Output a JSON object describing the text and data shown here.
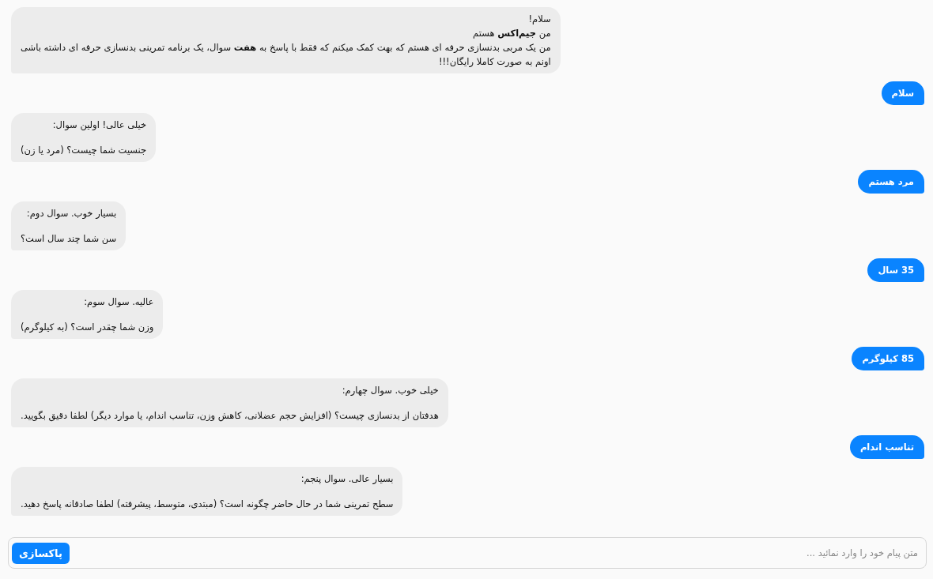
{
  "messages": [
    {
      "kind": "incoming",
      "paragraphs": [
        [
          "سلام!",
          "من **جیم‌اکس** هستم",
          "من یک مربی بدنسازی حرفه ای هستم که بهت کمک میکنم که فقط با پاسخ به **هفت** سوال، یک برنامه تمرینی بدنسازی حرفه ای داشته باشی",
          "اونم به صورت کاملا رایگان!!!"
        ]
      ]
    },
    {
      "kind": "outgoing",
      "paragraphs": [
        [
          "سلام"
        ]
      ]
    },
    {
      "kind": "incoming",
      "paragraphs": [
        [
          "خیلی عالی! اولین سوال:"
        ],
        [
          "جنسیت شما چیست؟ (مرد یا زن)"
        ]
      ]
    },
    {
      "kind": "outgoing",
      "paragraphs": [
        [
          "مرد هستم"
        ]
      ]
    },
    {
      "kind": "incoming",
      "paragraphs": [
        [
          "بسیار خوب. سوال دوم:"
        ],
        [
          "سن شما چند سال است؟"
        ]
      ]
    },
    {
      "kind": "outgoing",
      "paragraphs": [
        [
          "35 سال"
        ]
      ]
    },
    {
      "kind": "incoming",
      "paragraphs": [
        [
          "عالیه. سوال سوم:"
        ],
        [
          "وزن شما چقدر است؟ (به کیلوگرم)"
        ]
      ]
    },
    {
      "kind": "outgoing",
      "paragraphs": [
        [
          "85 کیلوگرم"
        ]
      ]
    },
    {
      "kind": "incoming",
      "paragraphs": [
        [
          "خیلی خوب. سوال چهارم:"
        ],
        [
          "هدفتان از بدنسازی چیست؟ (افزایش حجم عضلانی، کاهش وزن، تناسب اندام، یا موارد دیگر) لطفا دقیق بگویید."
        ]
      ]
    },
    {
      "kind": "outgoing",
      "paragraphs": [
        [
          "تناسب اندام"
        ]
      ]
    },
    {
      "kind": "incoming",
      "paragraphs": [
        [
          "بسیار عالی. سوال پنجم:"
        ],
        [
          "سطح تمرینی شما در حال حاضر چگونه است؟ (مبتدی، متوسط، پیشرفته) لطفا صادقانه پاسخ دهید."
        ]
      ]
    }
  ],
  "composer": {
    "placeholder": "متن پیام خود را وارد نمائید ...",
    "button": "پاکسازی"
  }
}
